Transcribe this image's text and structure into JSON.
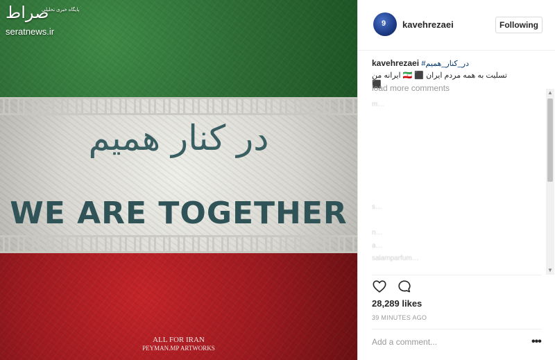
{
  "image": {
    "watermark": {
      "logo_text": "صراط",
      "tagline": "پایگاه خبری تحلیلی",
      "url": "seratnews.ir"
    },
    "persian_title": "در کنار همیم",
    "english_title": "WE ARE TOGETHER",
    "credit_line1": "ALL FOR IRAN",
    "credit_line2": "PEYMAN.MP ARTWORKS",
    "colors": {
      "green": "#2e6e36",
      "white": "#e2e1db",
      "red": "#9b1a1f",
      "title": "#2f5357"
    }
  },
  "header": {
    "avatar_number": "9",
    "username": "kavehrezaei",
    "follow_button": "Following"
  },
  "caption": {
    "username": "kavehrezaei",
    "hashtag": "#در_کنار_همیم",
    "text": "تسلیت به همه مردم ایران ⬛ 🇮🇷 ایرانه من ⬛"
  },
  "load_more": "load more comments",
  "comments": [
    "m…",
    "",
    "",
    "",
    "",
    "",
    "",
    "",
    "s…",
    "",
    "n…",
    "a…",
    "salamparfum…",
    "ali_…"
  ],
  "likes": "28,289 likes",
  "time": "39 MINUTES AGO",
  "comment_placeholder": "Add a comment...",
  "icons": {
    "like": "heart-icon",
    "comment": "comment-bubble-icon",
    "more": "more-options-icon"
  }
}
